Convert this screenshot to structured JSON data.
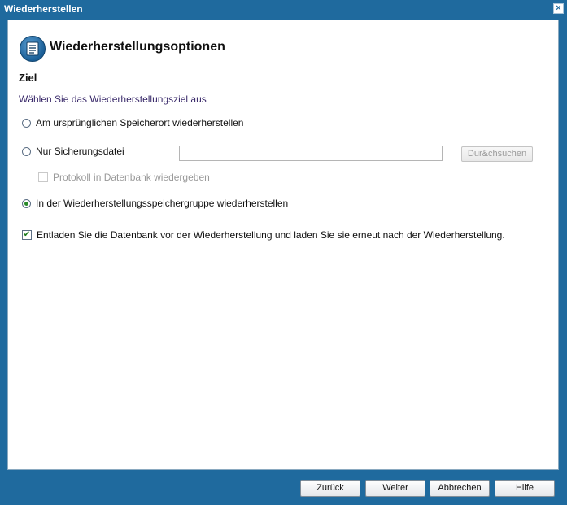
{
  "window": {
    "title": "Wiederherstellen",
    "close_label": "×"
  },
  "header": {
    "title": "Wiederherstellungsoptionen",
    "icon": "document-list-icon"
  },
  "section": {
    "title": "Ziel",
    "subtitle": "Wählen Sie das Wiederherstellungsziel aus"
  },
  "options": {
    "original_location": {
      "label": "Am ursprünglichen Speicherort wiederherstellen",
      "selected": false
    },
    "backup_file_only": {
      "label": "Nur Sicherungsdatei",
      "selected": false,
      "path_value": "",
      "browse_label": "Dur&chsuchen"
    },
    "replay_log": {
      "label": "Protokoll in Datenbank wiedergeben",
      "checked": false,
      "disabled": true
    },
    "recovery_group": {
      "label": "In der Wiederherstellungsspeichergruppe wiederherstellen",
      "selected": true
    },
    "dismount_db": {
      "label": "Entladen Sie die Datenbank vor der Wiederherstellung und laden Sie sie erneut nach der Wiederherstellung.",
      "checked": true
    }
  },
  "footer": {
    "back": "Zurück",
    "next": "Weiter",
    "cancel": "Abbrechen",
    "help": "Hilfe"
  },
  "colors": {
    "frame": "#1f6a9e",
    "radio_selected": "#2a8a2a"
  }
}
